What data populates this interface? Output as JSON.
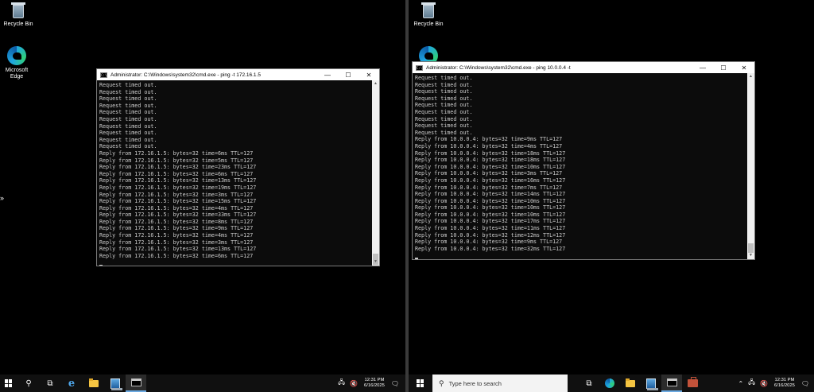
{
  "left": {
    "desktop_icons": [
      {
        "label": "Recycle Bin",
        "icon": "recycle-bin-icon"
      },
      {
        "label": "Microsoft Edge",
        "icon": "edge-icon"
      }
    ],
    "cmd": {
      "title": "Administrator: C:\\Windows\\system32\\cmd.exe - ping  -t 172.16.1.5",
      "output": "Request timed out.\nRequest timed out.\nRequest timed out.\nRequest timed out.\nRequest timed out.\nRequest timed out.\nRequest timed out.\nRequest timed out.\nRequest timed out.\nRequest timed out.\nReply from 172.16.1.5: bytes=32 time=6ms TTL=127\nReply from 172.16.1.5: bytes=32 time=5ms TTL=127\nReply from 172.16.1.5: bytes=32 time=23ms TTL=127\nReply from 172.16.1.5: bytes=32 time=6ms TTL=127\nReply from 172.16.1.5: bytes=32 time=13ms TTL=127\nReply from 172.16.1.5: bytes=32 time=19ms TTL=127\nReply from 172.16.1.5: bytes=32 time=3ms TTL=127\nReply from 172.16.1.5: bytes=32 time=15ms TTL=127\nReply from 172.16.1.5: bytes=32 time=4ms TTL=127\nReply from 172.16.1.5: bytes=32 time=33ms TTL=127\nReply from 172.16.1.5: bytes=32 time=8ms TTL=127\nReply from 172.16.1.5: bytes=32 time=9ms TTL=127\nReply from 172.16.1.5: bytes=32 time=4ms TTL=127\nReply from 172.16.1.5: bytes=32 time=3ms TTL=127\nReply from 172.16.1.5: bytes=32 time=13ms TTL=127\nReply from 172.16.1.5: bytes=32 time=6ms TTL=127\n"
    },
    "clock": {
      "time": "12:31 PM",
      "date": "6/16/2025"
    }
  },
  "right": {
    "desktop_icons": [
      {
        "label": "Recycle Bin",
        "icon": "recycle-bin-icon"
      }
    ],
    "cmd": {
      "title": "Administrator: C:\\Windows\\system32\\cmd.exe - ping  10.0.0.4 -t",
      "output": "Request timed out.\nRequest timed out.\nRequest timed out.\nRequest timed out.\nRequest timed out.\nRequest timed out.\nRequest timed out.\nRequest timed out.\nRequest timed out.\nReply from 10.0.0.4: bytes=32 time=9ms TTL=127\nReply from 10.0.0.4: bytes=32 time=4ms TTL=127\nReply from 10.0.0.4: bytes=32 time=18ms TTL=127\nReply from 10.0.0.4: bytes=32 time=18ms TTL=127\nReply from 10.0.0.4: bytes=32 time=10ms TTL=127\nReply from 10.0.0.4: bytes=32 time=3ms TTL=127\nReply from 10.0.0.4: bytes=32 time=16ms TTL=127\nReply from 10.0.0.4: bytes=32 time=7ms TTL=127\nReply from 10.0.0.4: bytes=32 time=14ms TTL=127\nReply from 10.0.0.4: bytes=32 time=10ms TTL=127\nReply from 10.0.0.4: bytes=32 time=10ms TTL=127\nReply from 10.0.0.4: bytes=32 time=10ms TTL=127\nReply from 10.0.0.4: bytes=32 time=17ms TTL=127\nReply from 10.0.0.4: bytes=32 time=11ms TTL=127\nReply from 10.0.0.4: bytes=32 time=12ms TTL=127\nReply from 10.0.0.4: bytes=32 time=9ms TTL=127\nReply from 10.0.0.4: bytes=32 time=32ms TTL=127\n"
    },
    "search_placeholder": "Type here to search",
    "clock": {
      "time": "12:31 PM",
      "date": "6/16/2025"
    }
  },
  "window_controls": {
    "minimize": "—",
    "maximize": "☐",
    "close": "✕"
  },
  "icons": {
    "side_arrow": "»",
    "search": "⚲",
    "task_view": "⧉",
    "ie": "e",
    "tray_up": "⌃",
    "network": "🖧",
    "volume": "🔇",
    "notifications": "🗨"
  },
  "colors": {
    "console_bg": "#0c0c0c",
    "console_text": "#cccccc",
    "taskbar_bg": "#101010",
    "active_underline": "#6aa8e0"
  }
}
